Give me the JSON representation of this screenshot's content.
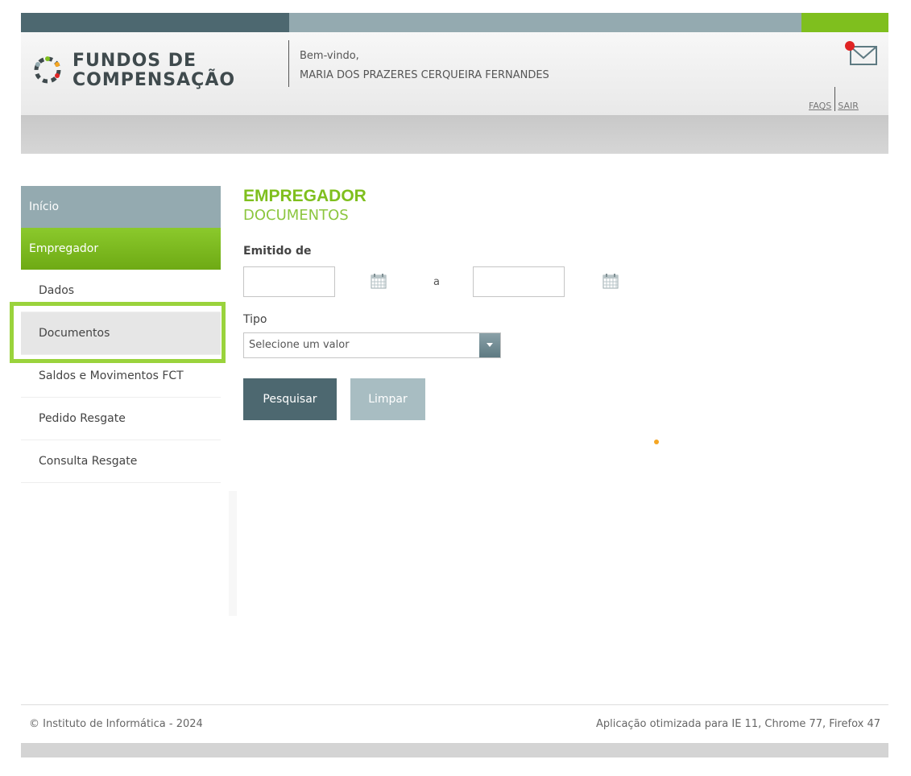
{
  "header": {
    "logo_line1": "FUNDOS DE",
    "logo_line2": "COMPENSAÇÃO",
    "welcome": "Bem-vindo,",
    "user_name": "MARIA DOS PRAZERES CERQUEIRA FERNANDES",
    "faqs": "FAQS",
    "logout": "SAIR",
    "mail_icon": "envelope-icon",
    "notification_color": "#e02424"
  },
  "sidebar": {
    "inicio": "Início",
    "empregador": "Empregador",
    "items": [
      {
        "label": "Dados"
      },
      {
        "label": "Documentos",
        "active": true
      },
      {
        "label": "Saldos e Movimentos FCT"
      },
      {
        "label": "Pedido Resgate"
      },
      {
        "label": "Consulta Resgate"
      }
    ]
  },
  "main": {
    "title": "EMPREGADOR",
    "subtitle": "DOCUMENTOS",
    "issued_label": "Emitido de",
    "date_from": "",
    "to_label": "a",
    "date_to": "",
    "type_label": "Tipo",
    "type_selected": "Selecione um valor",
    "search_button": "Pesquisar",
    "clear_button": "Limpar"
  },
  "footer": {
    "copyright": "© Instituto de Informática - 2024",
    "browser_note": "Aplicação otimizada para IE 11, Chrome 77, Firefox 47"
  },
  "colors": {
    "brand_dark": "#4d6870",
    "brand_light": "#94aab0",
    "accent_green": "#7fbf1e"
  }
}
